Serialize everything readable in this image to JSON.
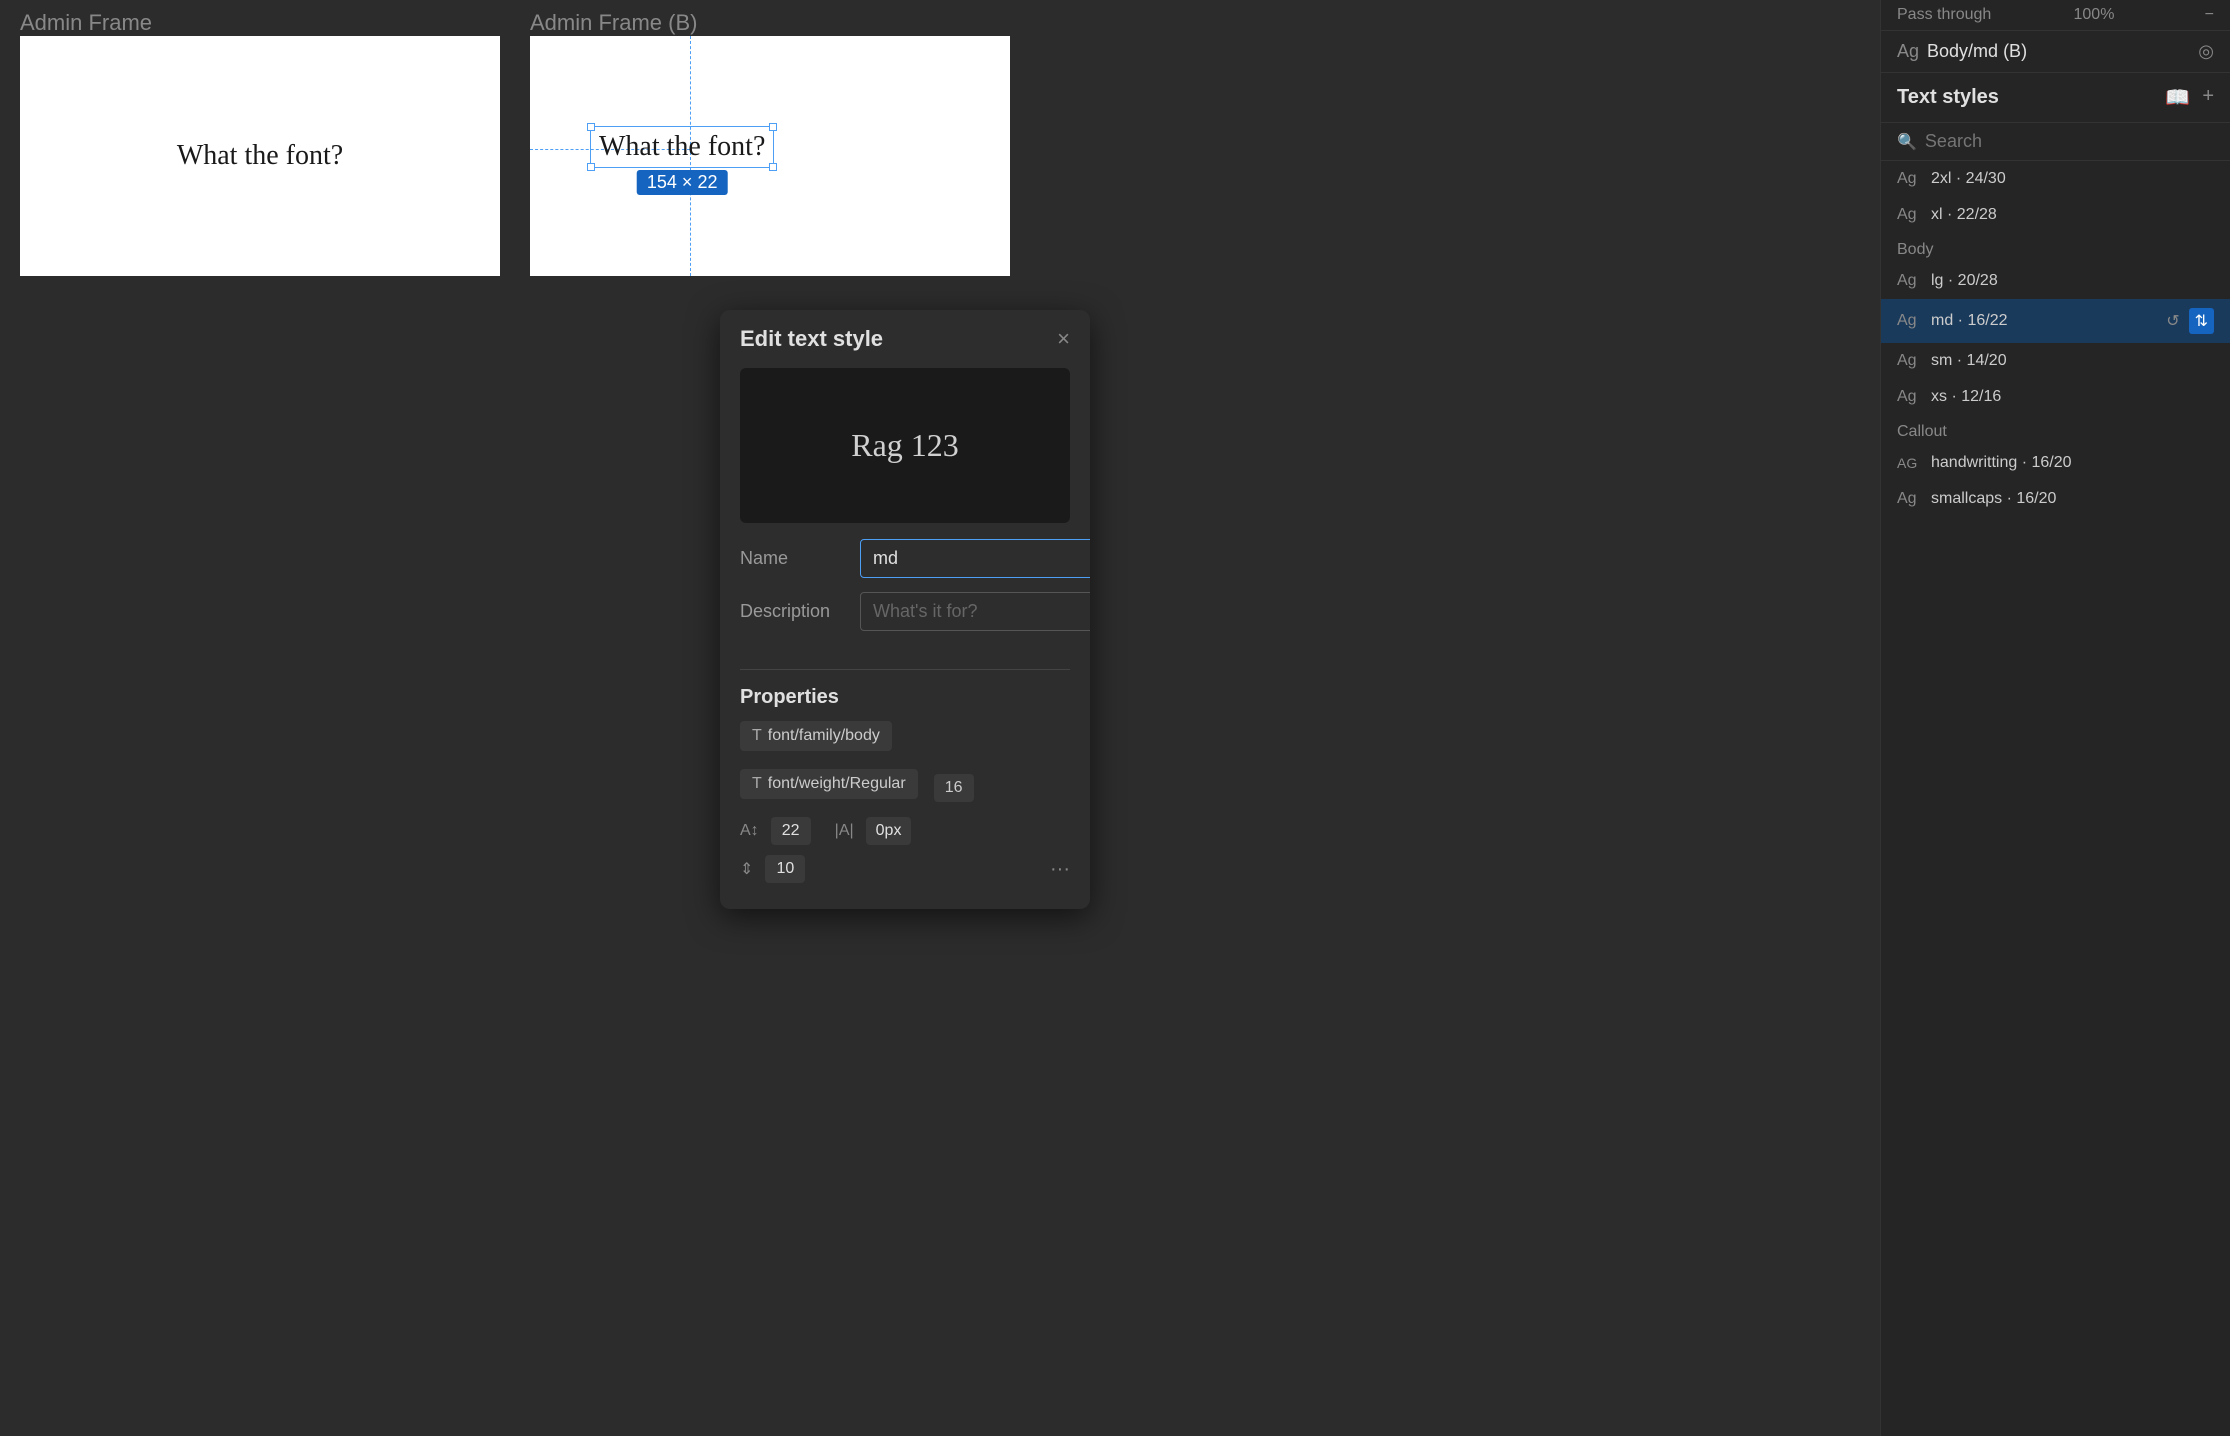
{
  "canvas": {
    "frame_a_label": "Admin Frame",
    "frame_b_label": "Admin Frame (B)",
    "frame_text": "What the font?",
    "selected_text": "What the font?",
    "dimension": "154 × 22"
  },
  "modal": {
    "title": "Edit text style",
    "preview_text": "Rag 123",
    "name_label": "Name",
    "name_value": "md",
    "description_label": "Description",
    "description_placeholder": "What's it for?",
    "properties_title": "Properties",
    "prop_font_family": "font/family/body",
    "prop_font_weight": "font/weight/Regular",
    "prop_size": "16",
    "prop_line_height": "22",
    "prop_letter_spacing": "0px",
    "prop_paragraph_spacing": "10",
    "close_label": "×"
  },
  "panel": {
    "passthrough_label": "Pass through",
    "passthrough_value": "100%",
    "style_ag": "Ag",
    "style_name": "Body/md (B)",
    "text_styles_title": "Text styles",
    "search_placeholder": "Search",
    "styles": [
      {
        "ag": "Ag",
        "name": "2xl · 24/30",
        "category": ""
      },
      {
        "ag": "Ag",
        "name": "xl · 22/28",
        "category": ""
      },
      {
        "ag": "Ag",
        "name": "lg · 20/28",
        "category": "Body"
      },
      {
        "ag": "Ag",
        "name": "md · 16/22",
        "category": "",
        "active": true
      },
      {
        "ag": "Ag",
        "name": "sm · 14/20",
        "category": ""
      },
      {
        "ag": "Ag",
        "name": "xs · 12/16",
        "category": ""
      },
      {
        "ag": "AG",
        "name": "handwritting · 16/20",
        "category": "Callout",
        "caps": true
      },
      {
        "ag": "Ag",
        "name": "smallcaps · 16/20",
        "category": ""
      }
    ]
  }
}
